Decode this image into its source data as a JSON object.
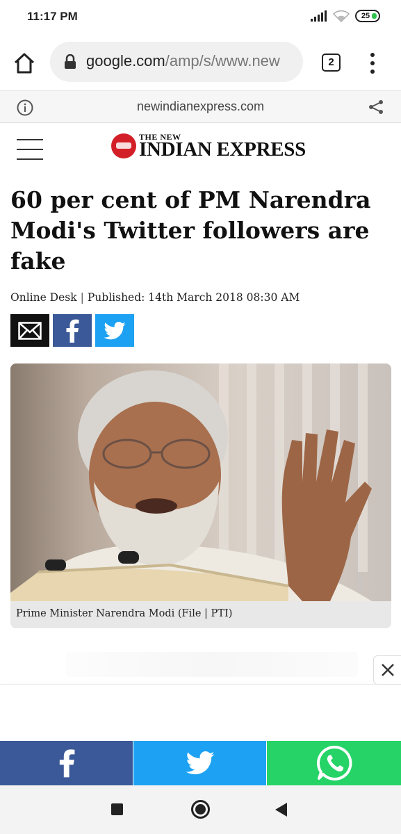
{
  "status_bar": {
    "time": "11:17 PM",
    "battery": "25",
    "icons": [
      "signal-icon",
      "wifi-icon",
      "battery-icon"
    ]
  },
  "browser": {
    "url_domain": "google.com",
    "url_path": "/amp/s/www.new",
    "tab_count": "2"
  },
  "amp_bar": {
    "domain": "newindianexpress.com"
  },
  "site": {
    "logo_small": "THE NEW",
    "logo_big": "INDIAN EXPRESS",
    "logo_color": "#d31f27"
  },
  "article": {
    "headline": "60 per cent of PM Narendra Modi's Twitter followers are fake",
    "author": "Online Desk",
    "separator": "|",
    "published": "Published: 14th March 2018 08:30 AM",
    "caption": "Prime Minister Narendra Modi (File | PTI)"
  },
  "social_top": [
    "mail-icon",
    "facebook-icon",
    "twitter-icon"
  ],
  "share_bar": {
    "colors": {
      "facebook": "#3b5998",
      "twitter": "#1da1f2",
      "whatsapp": "#25d366"
    }
  }
}
